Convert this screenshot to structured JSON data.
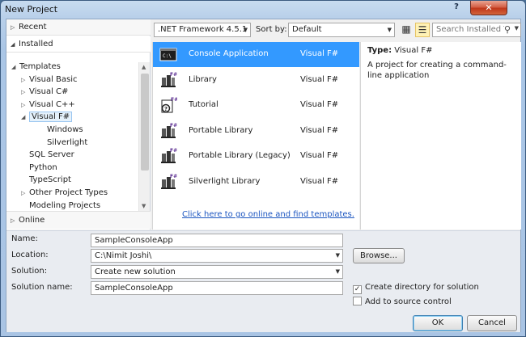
{
  "window": {
    "title": "New Project",
    "help": "?",
    "close": "✕"
  },
  "left": {
    "recent": "Recent",
    "installed": "Installed",
    "online": "Online",
    "tree": [
      {
        "label": "Templates",
        "level": 0,
        "toggle": "◢"
      },
      {
        "label": "Visual Basic",
        "level": 1,
        "toggle": "▷"
      },
      {
        "label": "Visual C#",
        "level": 1,
        "toggle": "▷"
      },
      {
        "label": "Visual C++",
        "level": 1,
        "toggle": "▷"
      },
      {
        "label": "Visual F#",
        "level": 1,
        "toggle": "◢",
        "selected": true
      },
      {
        "label": "Windows",
        "level": 2,
        "toggle": ""
      },
      {
        "label": "Silverlight",
        "level": 2,
        "toggle": ""
      },
      {
        "label": "SQL Server",
        "level": 1,
        "toggle": ""
      },
      {
        "label": "Python",
        "level": 1,
        "toggle": ""
      },
      {
        "label": "TypeScript",
        "level": 1,
        "toggle": ""
      },
      {
        "label": "Other Project Types",
        "level": 1,
        "toggle": "▷"
      },
      {
        "label": "Modeling Projects",
        "level": 1,
        "toggle": ""
      }
    ]
  },
  "toolbar": {
    "framework": ".NET Framework 4.5.1",
    "sort_label": "Sort by:",
    "sort_value": "Default",
    "search_placeholder": "Search Installed Te"
  },
  "templates": [
    {
      "name": "Console Application",
      "lang": "Visual F#",
      "selected": true,
      "icon": "console-icon"
    },
    {
      "name": "Library",
      "lang": "Visual F#",
      "icon": "library-icon"
    },
    {
      "name": "Tutorial",
      "lang": "Visual F#",
      "icon": "tutorial-icon"
    },
    {
      "name": "Portable Library",
      "lang": "Visual F#",
      "icon": "portable-library-icon"
    },
    {
      "name": "Portable Library (Legacy)",
      "lang": "Visual F#",
      "icon": "portable-library-legacy-icon"
    },
    {
      "name": "Silverlight Library",
      "lang": "Visual F#",
      "icon": "silverlight-library-icon"
    }
  ],
  "online_link": "Click here to go online and find templates.",
  "description": {
    "type_label": "Type:",
    "type_value": "Visual F#",
    "text": "A project for creating a command-line application"
  },
  "form": {
    "name_label": "Name:",
    "name_value": "SampleConsoleApp",
    "location_label": "Location:",
    "location_value": "C:\\Nimit Joshi\\",
    "solution_label": "Solution:",
    "solution_value": "Create new solution",
    "solution_name_label": "Solution name:",
    "solution_name_value": "SampleConsoleApp",
    "browse": "Browse...",
    "create_dir": "Create directory for solution",
    "create_dir_checked": true,
    "source_control": "Add to source control",
    "source_control_checked": false,
    "ok": "OK",
    "cancel": "Cancel"
  }
}
